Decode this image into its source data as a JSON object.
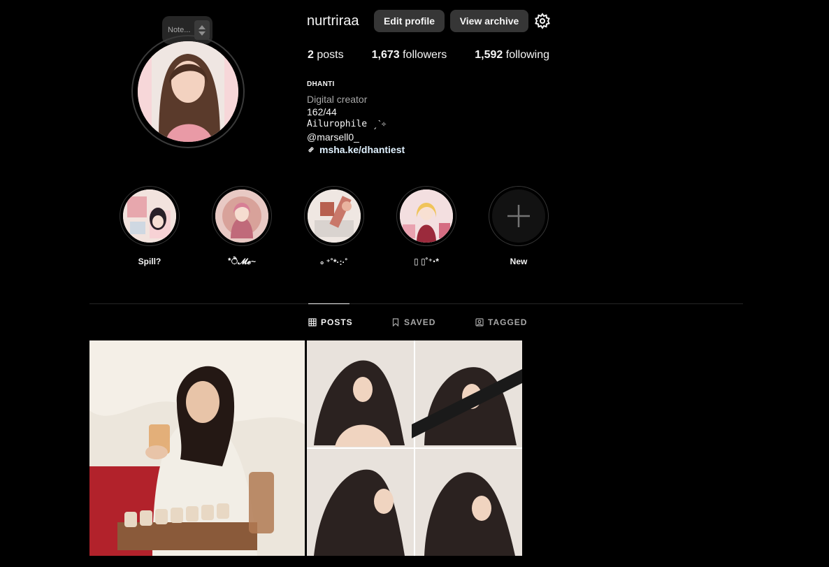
{
  "profile": {
    "username": "nurtriraa",
    "note_placeholder": "Note...",
    "edit_label": "Edit profile",
    "archive_label": "View archive",
    "settings_icon": "gear-icon"
  },
  "stats": {
    "posts_count": "2",
    "posts_label": "posts",
    "followers_count": "1,673",
    "followers_label": "followers",
    "following_count": "1,592",
    "following_label": "following"
  },
  "bio": {
    "name": "DHANTI",
    "category": "Digital creator",
    "line1": "162/44",
    "line2": "Ailurophile ˏˋ✧",
    "line3": "@marsell0_",
    "link": "msha.ke/dhantiest"
  },
  "highlights": [
    {
      "label": "Spill?"
    },
    {
      "label": "*ੈ𝓜𝓮~"
    },
    {
      "label": "৹ ⁺˚*·:·˚"
    },
    {
      "label": "▯ ▯˚⁺‧*"
    },
    {
      "label": "New"
    }
  ],
  "tabs": {
    "posts": "POSTS",
    "saved": "SAVED",
    "tagged": "TAGGED"
  },
  "colors": {
    "background": "#000000",
    "button": "#363636",
    "muted": "#a8a8a8",
    "link": "#e0f1ff"
  }
}
